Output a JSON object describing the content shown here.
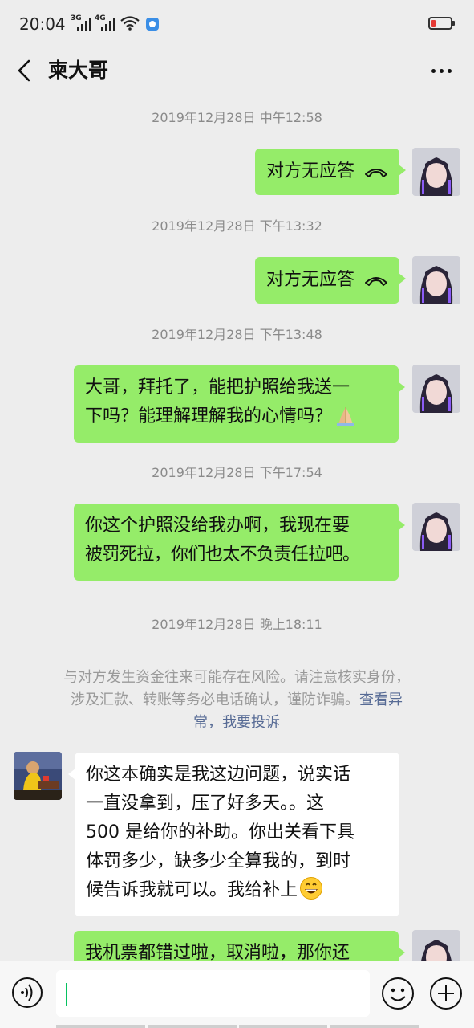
{
  "status_bar": {
    "time": "20:04",
    "signal_1": "3G",
    "signal_2": "4G",
    "wifi_icon": "wifi-icon",
    "battery_level_percent": 10,
    "battery_color": "#e53935"
  },
  "header": {
    "title": "柬大哥",
    "back_icon": "chevron-left-icon",
    "more_icon": "more-dots-icon"
  },
  "colors": {
    "my_bubble": "#95ec69",
    "their_bubble": "#ffffff",
    "background": "#ededed",
    "link": "#576b95"
  },
  "messages": [
    {
      "timestamp": "2019年12月28日 中午12:58",
      "sender": "me",
      "text": "对方无应答",
      "type": "call",
      "icon": "hangup-phone-icon"
    },
    {
      "timestamp": "2019年12月28日 下午13:32",
      "sender": "me",
      "text": "对方无应答",
      "type": "call",
      "icon": "hangup-phone-icon"
    },
    {
      "timestamp": "2019年12月28日 下午13:48",
      "sender": "me",
      "lines": [
        "大哥，拜托了，能把护照给我送一",
        "下吗？能理解理解我的心情吗？"
      ],
      "emoji": "folded-hands-emoji"
    },
    {
      "timestamp": "2019年12月28日 下午17:54",
      "sender": "me",
      "lines": [
        "你这个护照没给我办啊，我现在要",
        "被罚死拉，你们也太不负责任拉吧。"
      ]
    },
    {
      "timestamp": "2019年12月28日 晚上18:11"
    },
    {
      "sender": "them",
      "lines": [
        "你这本确实是我这边问题，说实话",
        "一直没拿到，压了好多天。。这",
        "500 是给你的补助。你出关看下具",
        "体罚多少，缺多少全算我的，到时",
        "候告诉我就可以。我给补上"
      ],
      "emoji": "grinning-face-emoji"
    },
    {
      "sender": "me",
      "lines": [
        "我机票都错过啦，取消啦，那你还"
      ]
    }
  ],
  "notice": {
    "line1": "与对方发生资金往来可能存在风险。请注意核实身份，",
    "line2_text": "涉及汇款、转账等务必电话确认，谨防诈骗。",
    "line2_link": "查看异",
    "line3_link": "常，我要投诉"
  },
  "input_bar": {
    "voice_icon": "voice-icon",
    "emoji_icon": "emoji-icon",
    "plus_icon": "plus-icon",
    "value": ""
  }
}
